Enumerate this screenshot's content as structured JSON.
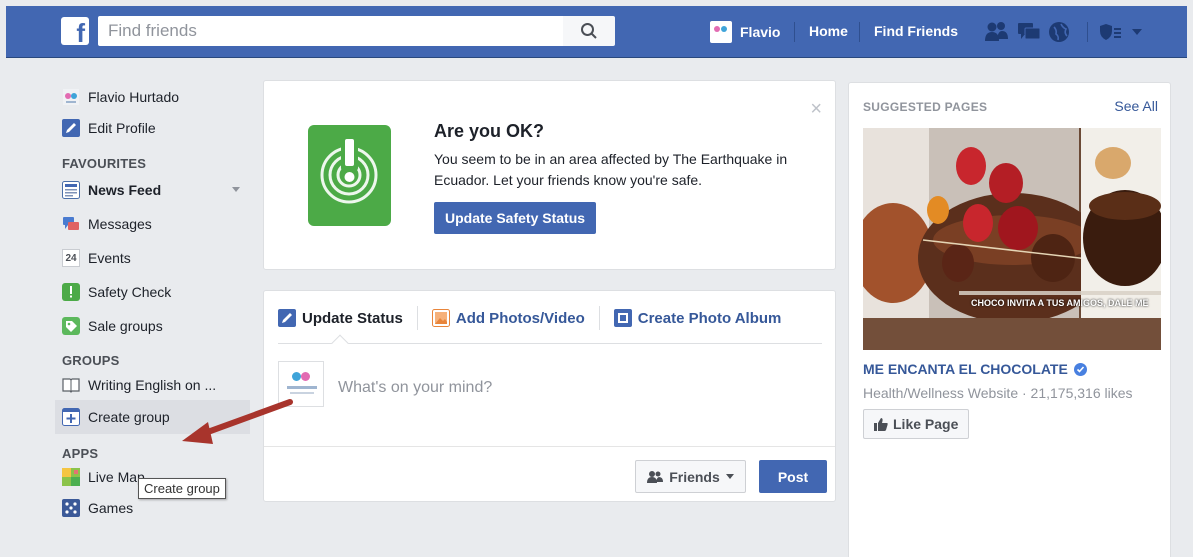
{
  "topbar": {
    "search_placeholder": "Find friends",
    "user_name": "Flavio",
    "home": "Home",
    "find_friends": "Find Friends"
  },
  "sidebar": {
    "profile_name": "Flavio Hurtado",
    "edit_profile": "Edit Profile",
    "favourites_header": "FAVOURITES",
    "favourites": [
      {
        "label": "News Feed",
        "icon": "news-feed-icon"
      },
      {
        "label": "Messages",
        "icon": "messages-icon"
      },
      {
        "label": "Events",
        "icon": "events-icon",
        "badge": "24"
      },
      {
        "label": "Safety Check",
        "icon": "safety-check-icon"
      },
      {
        "label": "Sale groups",
        "icon": "sale-groups-icon"
      }
    ],
    "groups_header": "GROUPS",
    "groups": [
      {
        "label": "Writing English on ...",
        "icon": "book-icon"
      },
      {
        "label": "Create group",
        "icon": "create-group-icon"
      }
    ],
    "apps_header": "APPS",
    "apps": [
      {
        "label": "Live Map",
        "icon": "live-map-icon"
      },
      {
        "label": "Games",
        "icon": "games-icon"
      }
    ],
    "tooltip": "Create group"
  },
  "safety": {
    "title": "Are you OK?",
    "text": "You seem to be in an area affected by The Earthquake in Ecuador. Let your friends know you're safe.",
    "button": "Update Safety Status",
    "close": "×"
  },
  "composer": {
    "tabs": [
      "Update Status",
      "Add Photos/Video",
      "Create Photo Album"
    ],
    "placeholder": "What's on your mind?",
    "audience": "Friends",
    "post": "Post"
  },
  "suggested": {
    "header": "SUGGESTED PAGES",
    "see_all": "See All",
    "page_name": "ME ENCANTA EL CHOCOLATE",
    "page_meta": "Health/Wellness Website · 21,175,316 likes",
    "like_button": "Like Page",
    "promo_caption": "CHOCO INVITA A TUS AMIGOS, DALE ME"
  },
  "colors": {
    "brand": "#4267b2",
    "link": "#365899",
    "safety_green": "#4caa47",
    "annotation_arrow": "#a8342c"
  }
}
